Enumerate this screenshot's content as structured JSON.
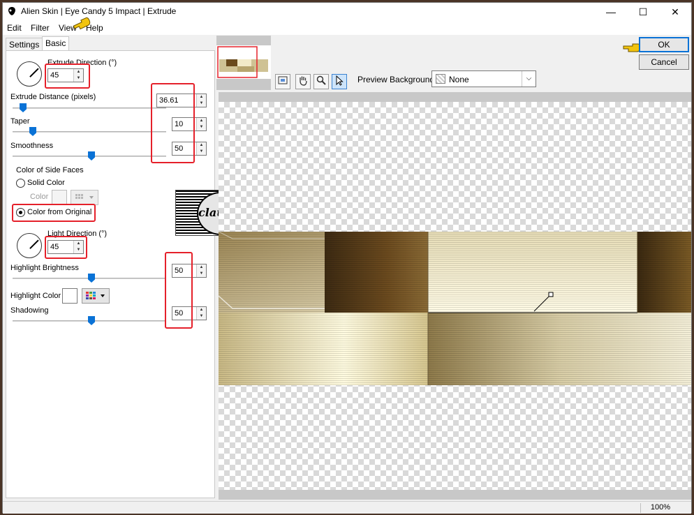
{
  "window": {
    "title": "Alien Skin | Eye Candy 5 Impact | Extrude",
    "minimize": "—",
    "maximize": "☐",
    "close": "✕"
  },
  "menu": [
    "Edit",
    "Filter",
    "View",
    "Help"
  ],
  "tabs": {
    "settings": "Settings",
    "basic": "Basic"
  },
  "basic": {
    "extrude_direction_label": "Extrude Direction (°)",
    "extrude_direction_value": "45",
    "extrude_distance_label": "Extrude Distance (pixels)",
    "extrude_distance_value": "36.61",
    "taper_label": "Taper",
    "taper_value": "10",
    "smoothness_label": "Smoothness",
    "smoothness_value": "50",
    "side_faces_label": "Color of Side Faces",
    "solid_color_label": "Solid Color",
    "color_label": "Color",
    "color_from_original_label": "Color from Original",
    "light_direction_label": "Light Direction (°)",
    "light_direction_value": "45",
    "highlight_brightness_label": "Highlight Brightness",
    "highlight_brightness_value": "50",
    "highlight_color_label": "Highlight Color",
    "shadowing_label": "Shadowing",
    "shadowing_value": "50"
  },
  "watermark": {
    "text": "claudia"
  },
  "preview": {
    "background_label": "Preview Background:",
    "background_value": "None",
    "zoom": "100%"
  },
  "buttons": {
    "ok": "OK",
    "cancel": "Cancel"
  },
  "colors": {
    "accent": "#0a72d6",
    "highlight_box": "#e5202a",
    "frame": "#4a3426"
  }
}
